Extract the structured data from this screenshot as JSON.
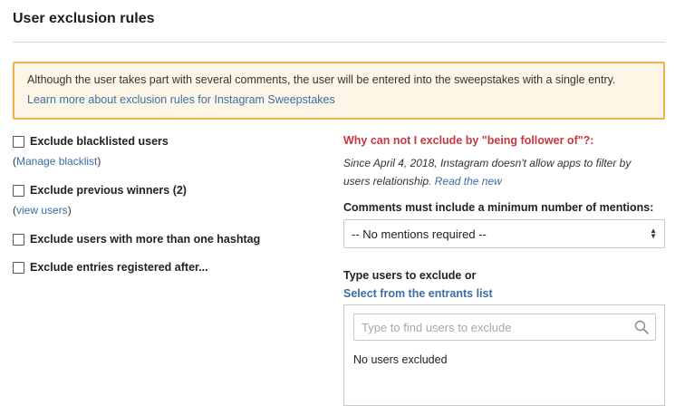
{
  "section": {
    "title": "User exclusion rules"
  },
  "notice": {
    "text": "Although the user takes part with several comments, the user will be entered into the sweepstakes with a single entry.",
    "link": "Learn more about exclusion rules for Instagram Sweepstakes"
  },
  "options": {
    "blacklisted": {
      "label": "Exclude blacklisted users",
      "sub_prefix": "(",
      "sub_link": "Manage blacklist",
      "sub_suffix": ")",
      "checked": false
    },
    "previous_winners": {
      "label": "Exclude previous winners (2)",
      "sub_prefix": "(",
      "sub_link": "view users",
      "sub_suffix": ")",
      "checked": false
    },
    "multi_hashtag": {
      "label": "Exclude users with more than one hashtag",
      "checked": false
    },
    "registered_after": {
      "label": "Exclude entries registered after...",
      "checked": false
    }
  },
  "follower_info": {
    "heading": "Why can not I exclude by \"being follower of\"?:",
    "text": "Since April 4, 2018, Instagram doesn't allow apps to filter by users relationship.",
    "link": "Read the new"
  },
  "mentions": {
    "label": "Comments must include a minimum number of mentions:",
    "selected": "-- No mentions required --"
  },
  "exclude_users": {
    "label": "Type users to exclude or",
    "link": "Select from the entrants list",
    "search_placeholder": "Type to find users to exclude",
    "search_value": "",
    "empty_text": "No users excluded"
  },
  "colors": {
    "notice_bg": "#fdf6e7",
    "notice_border": "#f0b14a",
    "link": "#3a6ea5",
    "warning": "#c8373c"
  }
}
